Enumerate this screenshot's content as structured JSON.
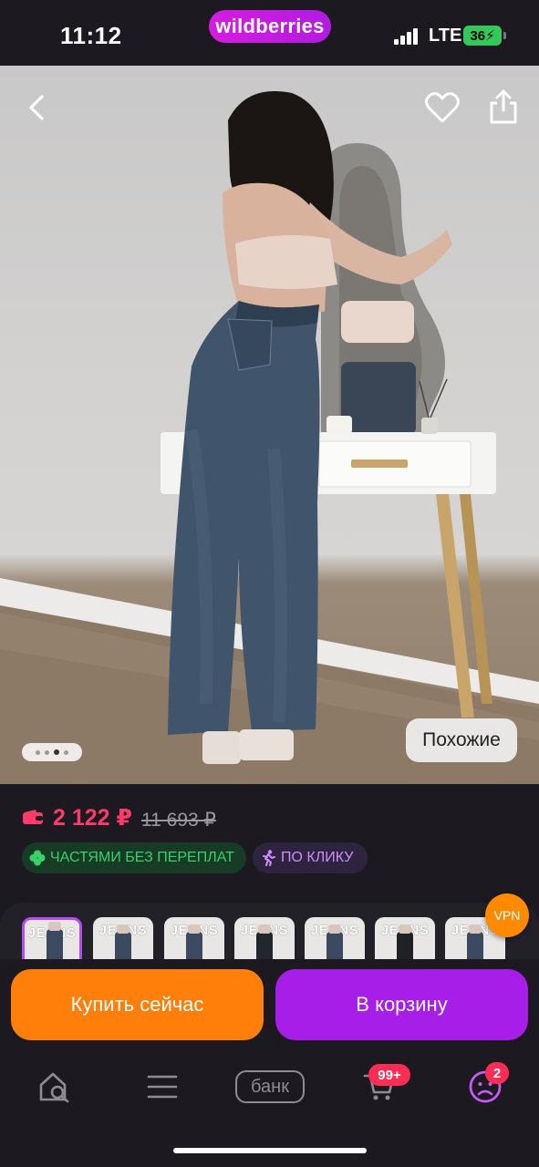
{
  "status_bar": {
    "time": "11:12",
    "brand": "wildberries",
    "network": "LTE",
    "battery": "36"
  },
  "gallery": {
    "total_images": 4,
    "active_index": 2,
    "similar_label": "Похожие"
  },
  "price": {
    "current": "2 122 ₽",
    "old": "11 693 ₽",
    "accent_color": "#ff3b6b"
  },
  "badges": [
    {
      "label": "ЧАСТЯМИ БЕЗ ПЕРЕПЛАТ",
      "icon": "clover-icon",
      "color": "#38d16a"
    },
    {
      "label": "ПО КЛИКУ",
      "icon": "running-person-icon",
      "color": "#d08cff"
    }
  ],
  "thumbnails": [
    {
      "text": "JEANS",
      "selected": true
    },
    {
      "text": "JEANS",
      "selected": false
    },
    {
      "text": "JEANS",
      "selected": false
    },
    {
      "text": "JEANS",
      "selected": false
    },
    {
      "text": "JEANS",
      "selected": false
    },
    {
      "text": "JEANS",
      "selected": false
    },
    {
      "text": "JEANS",
      "selected": false
    }
  ],
  "vpn_label": "VPN",
  "actions": {
    "buy_now": "Купить сейчас",
    "add_to_cart": "В корзину",
    "buy_color": "#ff7f0a",
    "cart_color": "#a71ee8"
  },
  "tab_bar": {
    "bank_label": "банк",
    "cart_count": "99+",
    "profile_count": "2"
  }
}
